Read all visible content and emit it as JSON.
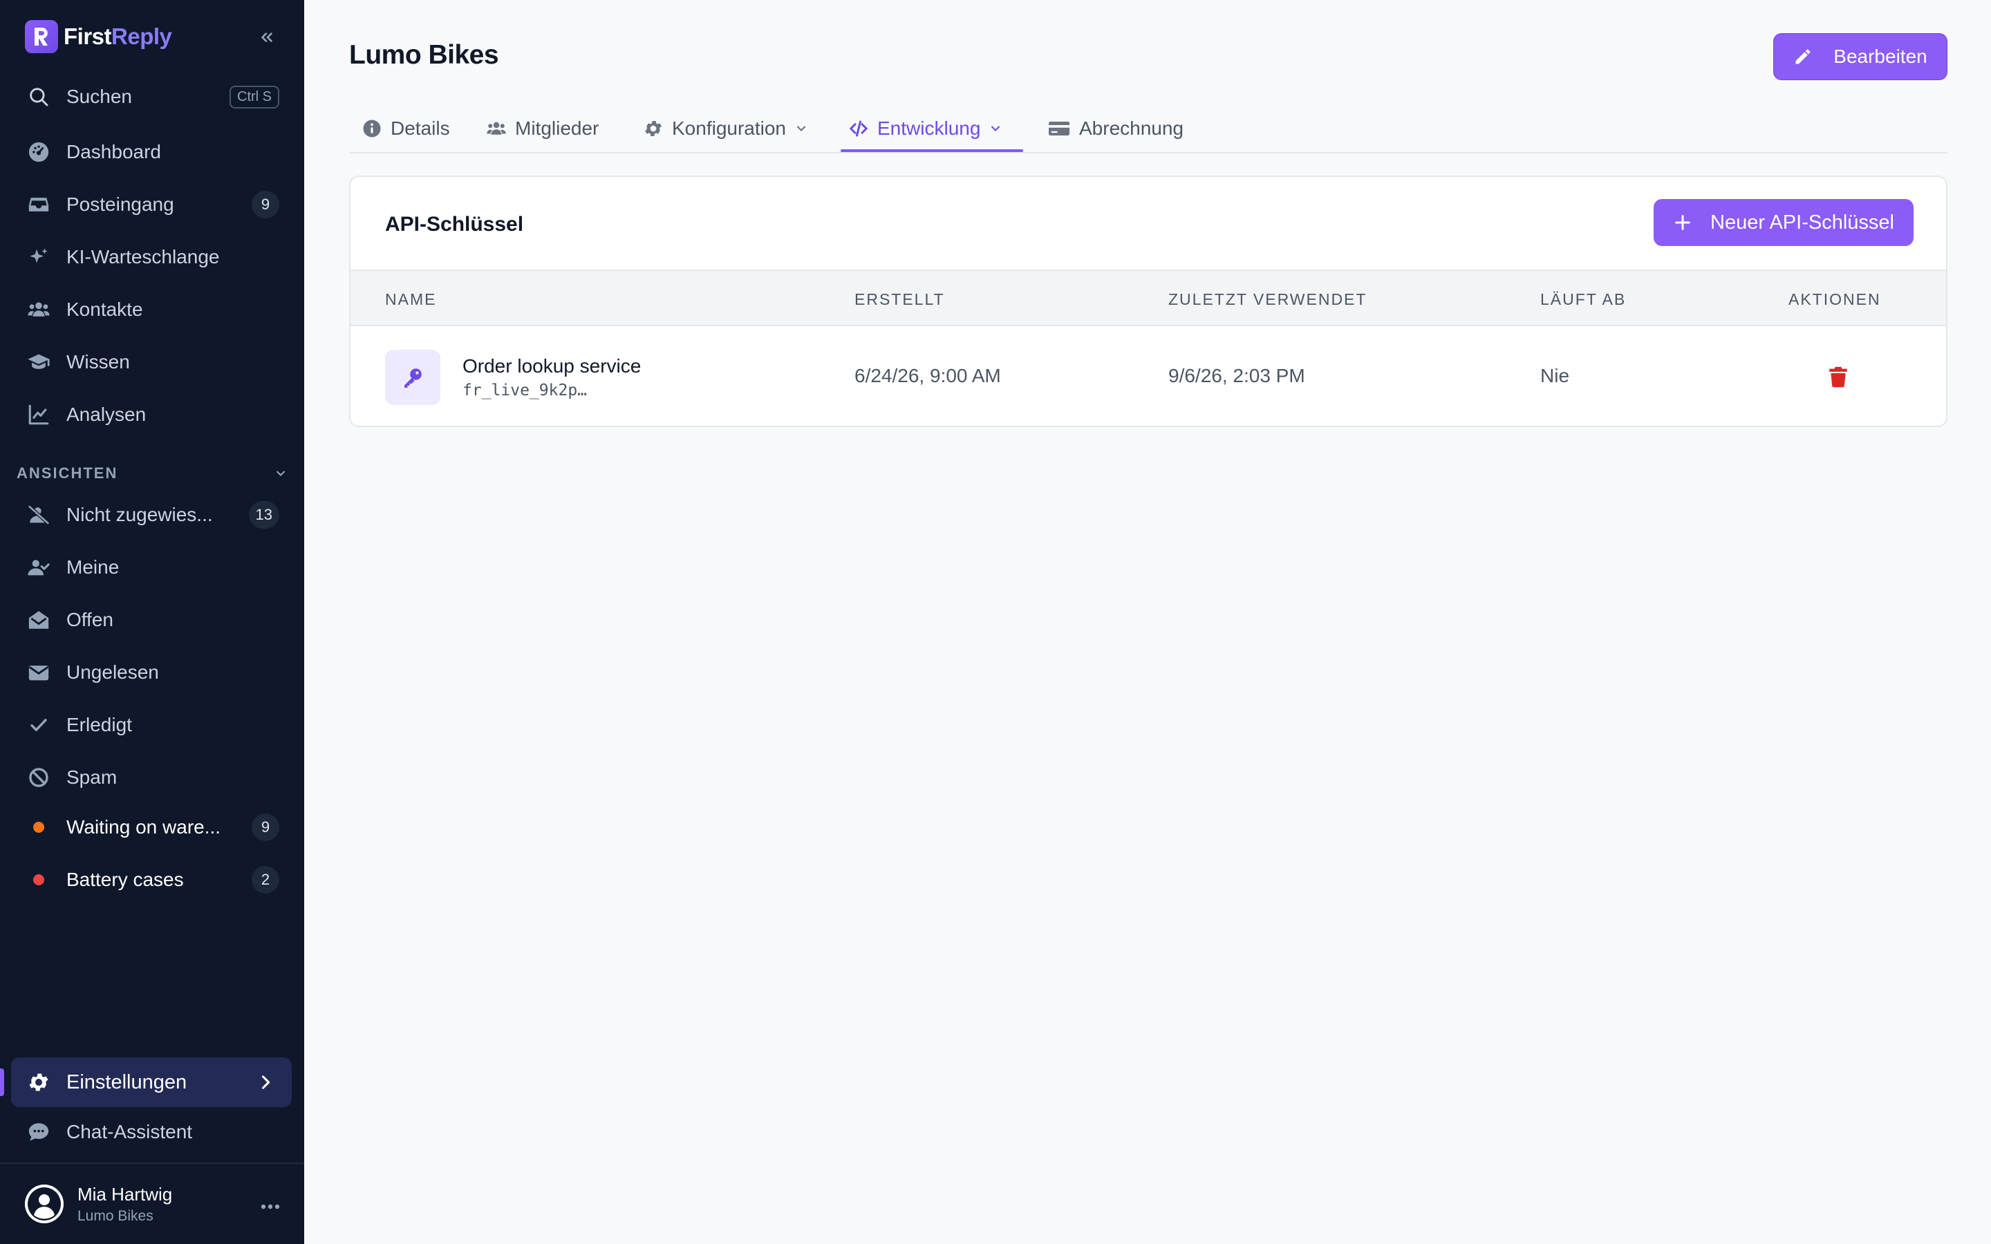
{
  "app": {
    "logo_part1": "First",
    "logo_part2": "Reply",
    "accent_color": "#8b5cf6"
  },
  "sidebar": {
    "search": {
      "label": "Suchen",
      "shortcut": "Ctrl S"
    },
    "items": [
      {
        "label": "Dashboard",
        "icon": "dashboard-gauge-icon"
      },
      {
        "label": "Posteingang",
        "icon": "inbox-icon",
        "count": "9"
      },
      {
        "label": "KI-Warteschlange",
        "icon": "sparkles-icon"
      },
      {
        "label": "Kontakte",
        "icon": "users-icon"
      },
      {
        "label": "Wissen",
        "icon": "graduation-cap-icon"
      },
      {
        "label": "Analysen",
        "icon": "chart-line-icon"
      }
    ],
    "views_header": "ANSICHTEN",
    "views": [
      {
        "label": "Nicht zugewies...",
        "icon": "user-slash-icon",
        "count": "13"
      },
      {
        "label": "Meine",
        "icon": "user-check-icon"
      },
      {
        "label": "Offen",
        "icon": "envelope-open-icon"
      },
      {
        "label": "Ungelesen",
        "icon": "envelope-icon"
      },
      {
        "label": "Erledigt",
        "icon": "check-icon"
      },
      {
        "label": "Spam",
        "icon": "ban-icon"
      },
      {
        "label": "Waiting on ware...",
        "dot_color": "#f97316",
        "count": "9"
      },
      {
        "label": "Battery cases",
        "dot_color": "#ef4444",
        "count": "2"
      }
    ],
    "settings": "Einstellungen",
    "chat_assistant": "Chat-Assistent",
    "user": {
      "name": "Mia Hartwig",
      "org": "Lumo Bikes"
    }
  },
  "main": {
    "title": "Lumo Bikes",
    "edit_button": "Bearbeiten",
    "tabs": [
      {
        "label": "Details",
        "icon": "info-circle-icon"
      },
      {
        "label": "Mitglieder",
        "icon": "users-icon"
      },
      {
        "label": "Konfiguration",
        "icon": "gear-icon",
        "dropdown": true
      },
      {
        "label": "Entwicklung",
        "icon": "code-icon",
        "dropdown": true,
        "active": true
      },
      {
        "label": "Abrechnung",
        "icon": "credit-card-icon"
      }
    ],
    "api_keys": {
      "title": "API-Schlüssel",
      "new_button": "Neuer API-Schlüssel",
      "columns": [
        "NAME",
        "ERSTELLT",
        "ZULETZT VERWENDET",
        "LÄUFT AB",
        "AKTIONEN"
      ],
      "rows": [
        {
          "name": "Order lookup service",
          "prefix": "fr_live_9k2p…",
          "created": "6/24/26, 9:00 AM",
          "last_used": "9/6/26, 2:03 PM",
          "expires": "Nie"
        }
      ]
    }
  }
}
